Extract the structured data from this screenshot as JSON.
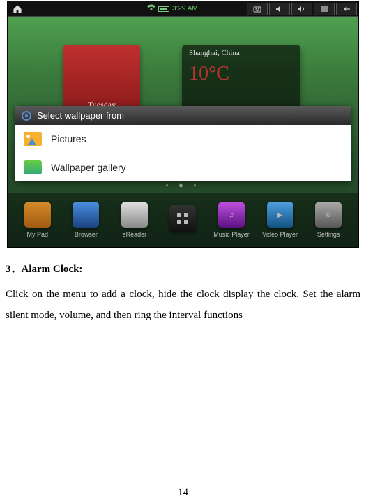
{
  "statusbar": {
    "time": "3:29 AM",
    "signal_icon": "wifi",
    "battery_icon": "battery"
  },
  "status_buttons": {
    "camera": "camera",
    "vol_up": "vol+",
    "vol_down": "vol-",
    "menu": "menu",
    "back": "back"
  },
  "widgets": {
    "calendar_day": "Tuesday",
    "weather_location": "Shanghai, China",
    "weather_temp": "10°C"
  },
  "dialog": {
    "title": "Select wallpaper from",
    "items": [
      {
        "label": "Pictures"
      },
      {
        "label": "Wallpaper gallery"
      }
    ]
  },
  "page_indicator": "• ● •",
  "dock": [
    {
      "label": "My Pad"
    },
    {
      "label": "Browser"
    },
    {
      "label": "eReader"
    },
    {
      "label": ""
    },
    {
      "label": "Music Player"
    },
    {
      "label": "Video Player"
    },
    {
      "label": "Settings"
    }
  ],
  "doc": {
    "heading_num": "3",
    "heading_sep": "．",
    "heading_title": "Alarm Clock:",
    "body": "Click on the menu to add a clock, hide the clock display the clock. Set the alarm silent mode, volume, and then ring the interval functions"
  },
  "page_number": "14"
}
